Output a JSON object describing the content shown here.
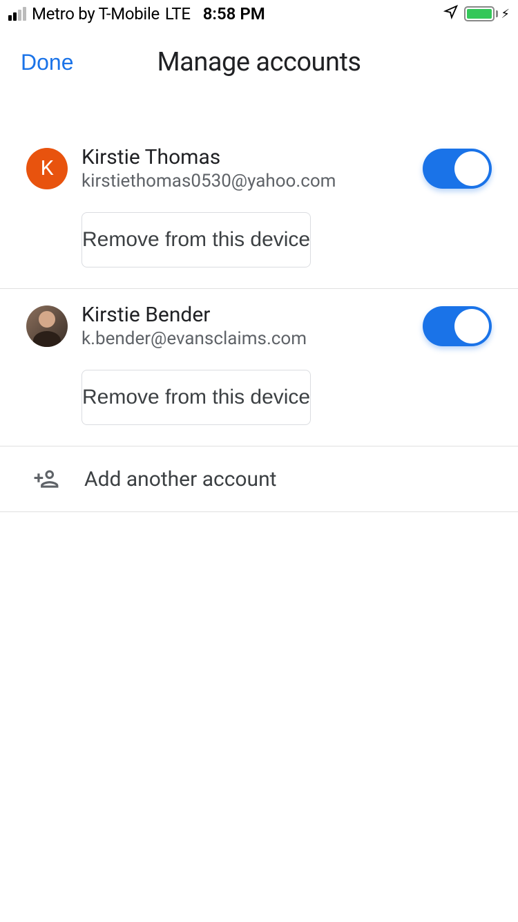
{
  "status": {
    "carrier": "Metro by T-Mobile",
    "network": "LTE",
    "time": "8:58 PM"
  },
  "header": {
    "done_label": "Done",
    "title": "Manage accounts"
  },
  "accounts": [
    {
      "name": "Kirstie Thomas",
      "email": "kirstiethomas0530@yahoo.com",
      "avatar_type": "initial",
      "avatar_initial": "K",
      "avatar_color": "orange",
      "enabled": true,
      "remove_label": "Remove from this device"
    },
    {
      "name": "Kirstie Bender",
      "email": "k.bender@evansclaims.com",
      "avatar_type": "photo",
      "enabled": true,
      "remove_label": "Remove from this device"
    }
  ],
  "add_account": {
    "label": "Add another account"
  }
}
